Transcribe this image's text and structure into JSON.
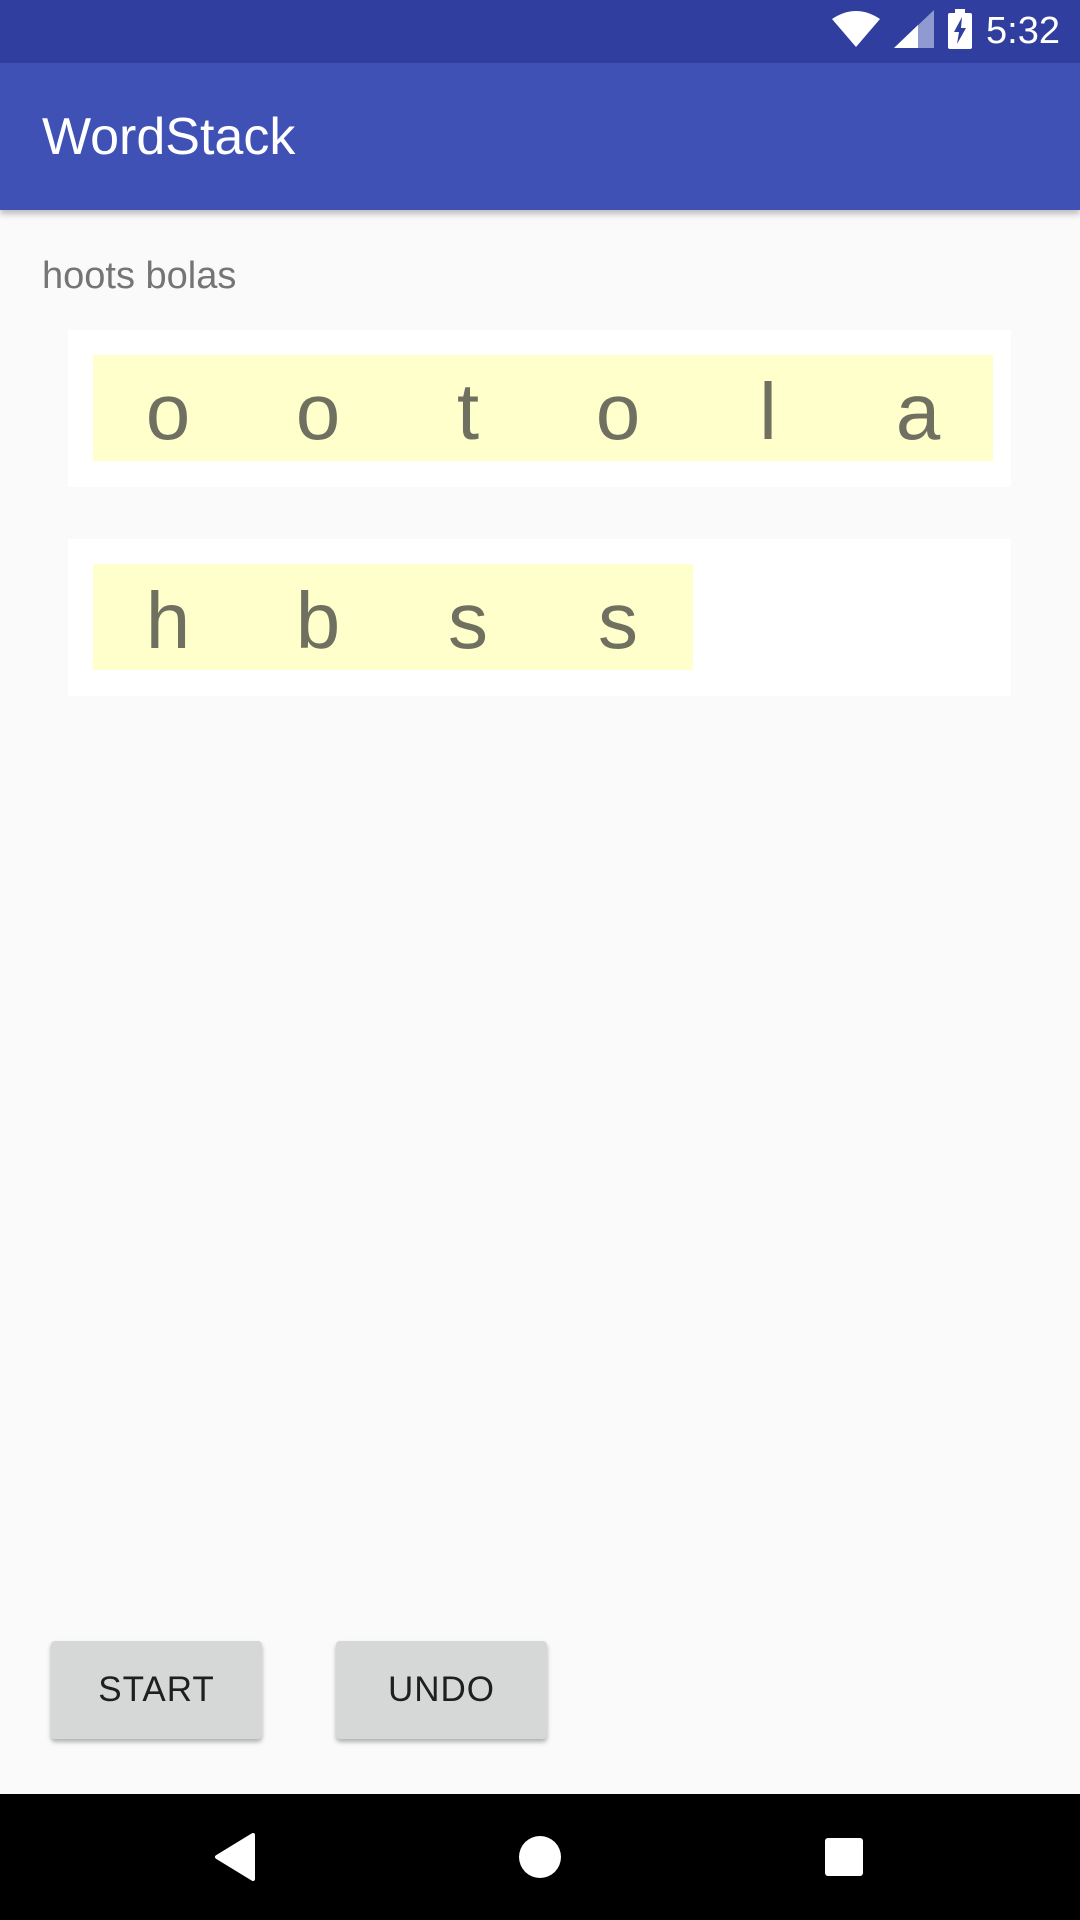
{
  "status_bar": {
    "time": "5:32",
    "icons": [
      "wifi-icon",
      "cell-signal-icon",
      "battery-charging-icon"
    ]
  },
  "app_bar": {
    "title": "WordStack"
  },
  "main": {
    "target_words": "hoots bolas",
    "stack_one": [
      "o",
      "o",
      "t",
      "o",
      "l",
      "a"
    ],
    "stack_two": [
      "h",
      "b",
      "s",
      "s"
    ]
  },
  "buttons": {
    "start_label": "START",
    "undo_label": "UNDO"
  },
  "nav_bar": {
    "icons": [
      "back-icon",
      "home-icon",
      "recents-icon"
    ]
  },
  "colors": {
    "status_bar": "#303f9f",
    "app_bar": "#3f51b5",
    "tile_background": "#ffffcc",
    "tile_text": "#707060",
    "button_background": "#d6d7d7"
  }
}
